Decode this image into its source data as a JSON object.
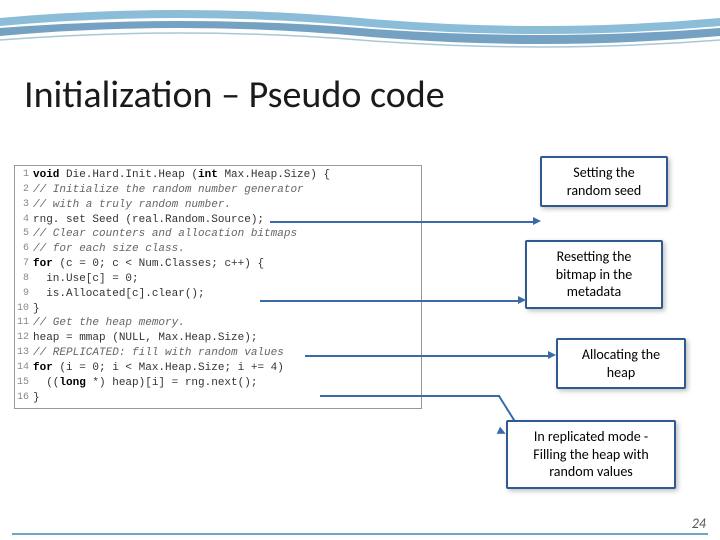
{
  "title": "Initialization – Pseudo code",
  "callouts": {
    "c1": "Setting the random seed",
    "c2": "Resetting the bitmap in the metadata",
    "c3": "Allocating the heap",
    "c4": "In replicated mode - Filling the heap with random values"
  },
  "code": {
    "l1a": "void",
    "l1b": " Die.Hard.Init.Heap (",
    "l1c": "int",
    "l1d": " Max.Heap.Size) {",
    "l2": "// Initialize the random number generator",
    "l3": "// with a truly random number.",
    "l4": "rng. set Seed (real.Random.Source);",
    "l5": "// Clear counters and allocation bitmaps",
    "l6": "// for each size class.",
    "l7a": "for",
    "l7b": " (c = 0; c < Num.Classes; c++) {",
    "l8": "  in.Use[c] = 0;",
    "l9": "  is.Allocated[c].clear();",
    "l10": "}",
    "l11": "// Get the heap memory.",
    "l12": "heap = mmap (NULL, Max.Heap.Size);",
    "l13": "// REPLICATED: fill with random values",
    "l14a": "for",
    "l14b": " (i = 0; i < Max.Heap.Size; i += 4)",
    "l15a": "  ((",
    "l15b": "long",
    "l15c": " *) heap)[i] = rng.next();",
    "l16": "}"
  },
  "slide_number": "24"
}
